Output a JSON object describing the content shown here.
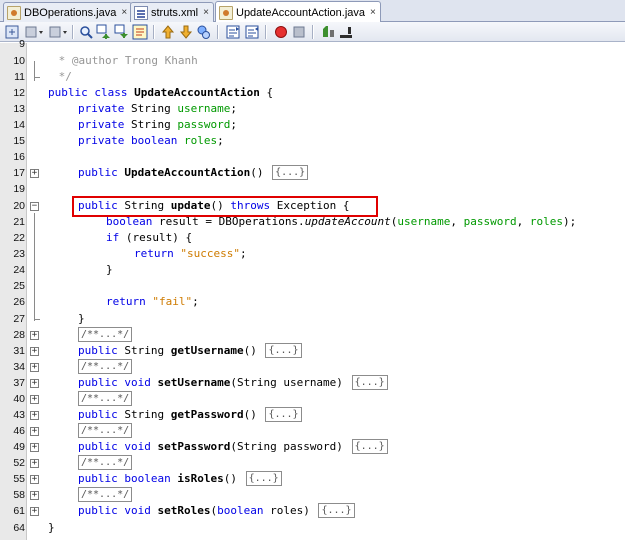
{
  "tabs": [
    {
      "label": "DBOperations.java",
      "close": "×",
      "icon": "java-file-icon",
      "active": false
    },
    {
      "label": "struts.xml",
      "close": "×",
      "icon": "xml-file-icon",
      "active": false
    },
    {
      "label": "UpdateAccountAction.java",
      "close": "×",
      "icon": "java-file-icon",
      "active": true
    }
  ],
  "toolbar": {
    "buttons": [
      "history-icon",
      "back-icon",
      "forward-icon",
      "find-icon",
      "find-previous-icon",
      "find-next-icon",
      "toggle-highlight-icon",
      "shift-left-icon",
      "shift-right-icon",
      "toggle-bookmark-icon",
      "previous-bookmark-icon",
      "next-bookmark-icon",
      "start-macro-icon",
      "stop-macro-icon",
      "comment-icon",
      "uncomment-icon"
    ]
  },
  "editor": {
    "fold_collapsed_symbol": "+",
    "fold_expanded_symbol": "−",
    "folded_body": "{...}",
    "folded_doc": "/**...*/",
    "lines": {
      "l9": {
        "num": "9"
      },
      "l10": {
        "num": "10",
        "t1": " * ",
        "t2": "@author",
        "t3": " Trong Khanh"
      },
      "l11": {
        "num": "11",
        "t1": " */"
      },
      "l12": {
        "num": "12",
        "k1": "public class ",
        "t2": "UpdateAccountAction",
        "t3": " {"
      },
      "l13": {
        "num": "13",
        "k1": "private ",
        "t2": "String ",
        "f3": "username",
        "t4": ";"
      },
      "l14": {
        "num": "14",
        "k1": "private ",
        "t2": "String ",
        "f3": "password",
        "t4": ";"
      },
      "l15": {
        "num": "15",
        "k1": "private boolean ",
        "f3": "roles",
        "t4": ";"
      },
      "l16": {
        "num": "16"
      },
      "l17": {
        "num": "17",
        "k1": "public ",
        "t2": "UpdateAccountAction",
        "t3": "() "
      },
      "l19": {
        "num": "19"
      },
      "l20": {
        "num": "20",
        "k1": "public ",
        "t2": "String ",
        "t3": "update",
        "t4": "() ",
        "k5": "throws ",
        "t6": "Exception {"
      },
      "l21": {
        "num": "21",
        "k1": "boolean ",
        "t2": "result = DBOperations.",
        "t3": "updateAccount",
        "t4": "(",
        "f5": "username",
        "t6": ", ",
        "f7": "password",
        "t8": ", ",
        "f9": "roles",
        "t10": ");"
      },
      "l22": {
        "num": "22",
        "k1": "if ",
        "t2": "(result) {"
      },
      "l23": {
        "num": "23",
        "k1": "return ",
        "s2": "\"success\"",
        "t3": ";"
      },
      "l24": {
        "num": "24",
        "t1": "}"
      },
      "l25": {
        "num": "25"
      },
      "l26": {
        "num": "26",
        "k1": "return ",
        "s2": "\"fail\"",
        "t3": ";"
      },
      "l27": {
        "num": "27",
        "t1": "}"
      },
      "l28": {
        "num": "28"
      },
      "l31": {
        "num": "31",
        "k1": "public ",
        "t2": "String ",
        "t3": "getUsername",
        "t4": "() "
      },
      "l34": {
        "num": "34"
      },
      "l37": {
        "num": "37",
        "k1": "public void ",
        "t3": "setUsername",
        "t4": "(String username) "
      },
      "l40": {
        "num": "40"
      },
      "l43": {
        "num": "43",
        "k1": "public ",
        "t2": "String ",
        "t3": "getPassword",
        "t4": "() "
      },
      "l46": {
        "num": "46"
      },
      "l49": {
        "num": "49",
        "k1": "public void ",
        "t3": "setPassword",
        "t4": "(String password) "
      },
      "l52": {
        "num": "52"
      },
      "l55": {
        "num": "55",
        "k1": "public boolean ",
        "t3": "isRoles",
        "t4": "() "
      },
      "l58": {
        "num": "58"
      },
      "l61": {
        "num": "61",
        "k1": "public void ",
        "t3": "setRoles",
        "t4": "(",
        "k5": "boolean ",
        "t6": "roles) "
      },
      "l64": {
        "num": "64",
        "t1": "}"
      }
    }
  },
  "colors": {
    "keyword": "#0000e6",
    "field": "#009900",
    "string": "#ce7b00",
    "comment": "#969696",
    "highlight_box": "#e00000"
  }
}
